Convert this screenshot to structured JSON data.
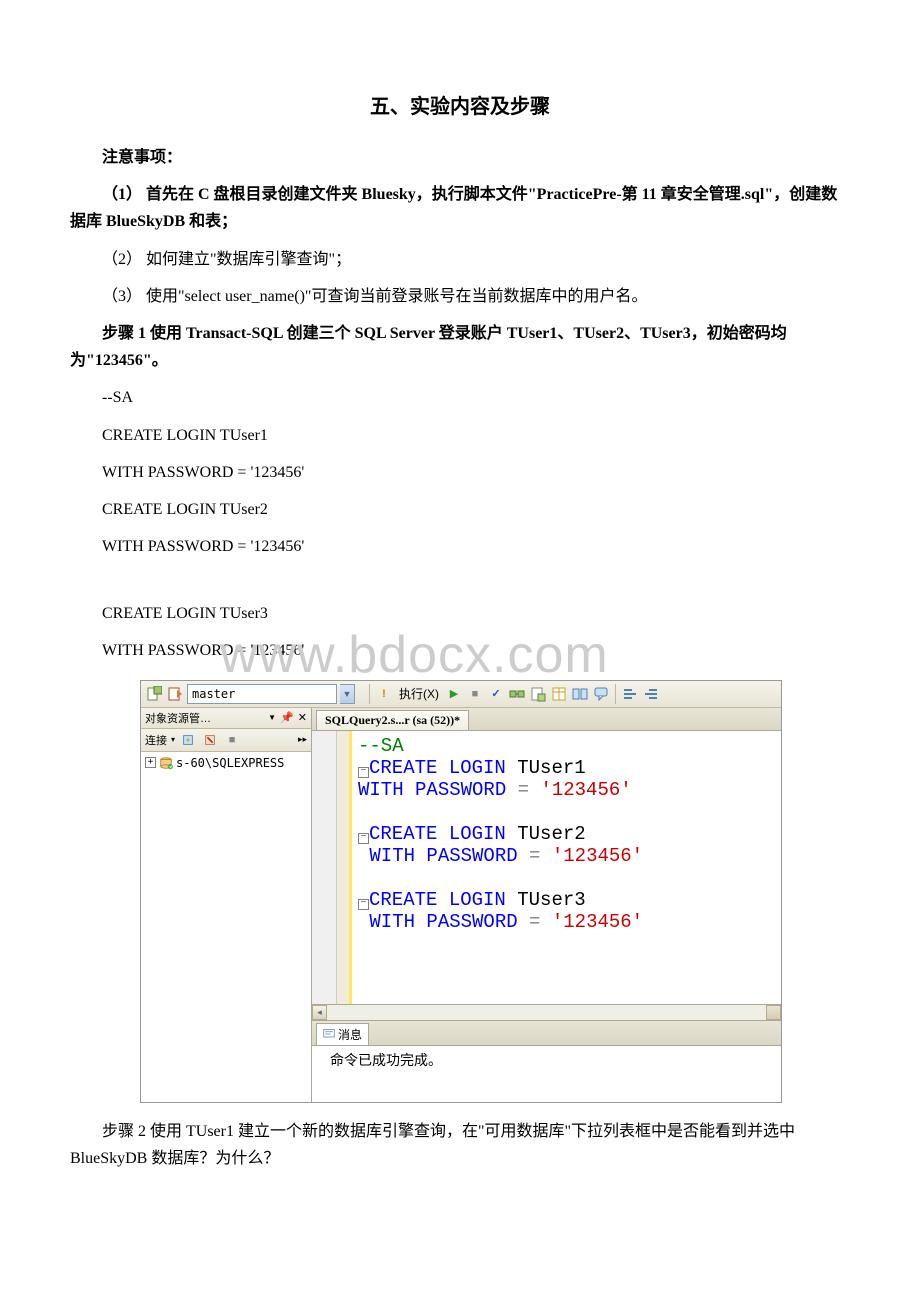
{
  "title": "五、实验内容及步骤",
  "notice_label": "注意事项：",
  "notice1": "（1） 首先在 C 盘根目录创建文件夹 Bluesky，执行脚本文件\"PracticePre-第 11 章安全管理.sql\"，创建数据库 BlueSkyDB 和表；",
  "notice2": "（2） 如何建立\"数据库引擎查询\"；",
  "notice3": "（3） 使用\"select user_name()\"可查询当前登录账号在当前数据库中的用户名。",
  "step1": "步骤 1 使用 Transact-SQL 创建三个 SQL Server 登录账户 TUser1、TUser2、TUser3，初始密码均为\"123456\"。",
  "code_lines": [
    "--SA",
    "CREATE LOGIN TUser1",
    "WITH PASSWORD = '123456'",
    "CREATE LOGIN TUser2",
    " WITH PASSWORD = '123456'",
    "",
    "CREATE LOGIN TUser3",
    " WITH PASSWORD = '123456'"
  ],
  "watermark": "www.bdocx.com",
  "ssms": {
    "db_selected": "master",
    "exec_label": "执行(X)",
    "obj_explorer_title": "对象资源管…",
    "connect_label": "连接",
    "tree_server": "s-60\\SQLEXPRESS",
    "query_tab": "SQLQuery2.s...r (sa (52))*",
    "editor": {
      "l1": "--SA",
      "l2a": "CREATE",
      "l2b": " LOGIN",
      "l2c": " TUser1",
      "l3a": "WITH",
      "l3b": " PASSWORD",
      "l3c": " = ",
      "l3d": "'123456'",
      "l5a": "CREATE",
      "l5b": " LOGIN",
      "l5c": " TUser2",
      "l6a": " WITH",
      "l6b": " PASSWORD",
      "l6c": " = ",
      "l6d": "'123456'",
      "l8a": "CREATE",
      "l8b": " LOGIN",
      "l8c": " TUser3",
      "l9a": " WITH",
      "l9b": " PASSWORD",
      "l9c": " = ",
      "l9d": "'123456'"
    },
    "msg_tab": "消息",
    "msg_body": "命令已成功完成。"
  },
  "step2": "步骤 2 使用 TUser1 建立一个新的数据库引擎查询，在\"可用数据库\"下拉列表框中是否能看到并选中 BlueSkyDB 数据库？为什么？"
}
